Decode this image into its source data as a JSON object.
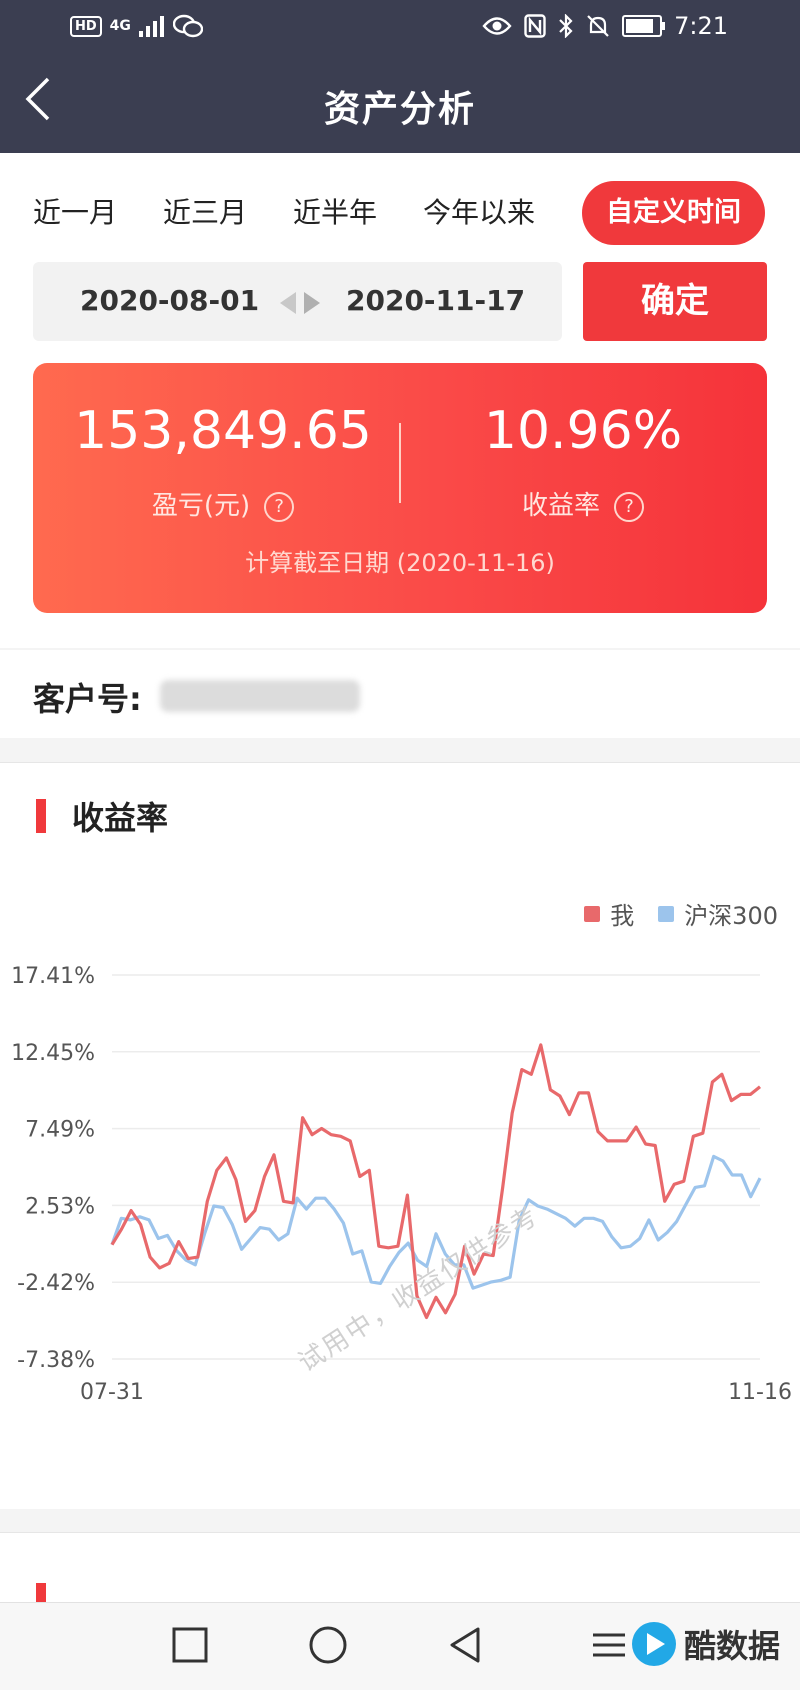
{
  "status": {
    "time": "7:21",
    "hd": "HD",
    "network": "4G",
    "battery_level": 0.85
  },
  "header": {
    "title": "资产分析",
    "back_glyph": "<"
  },
  "tabs": [
    {
      "label": "近一月",
      "active": false
    },
    {
      "label": "近三月",
      "active": false
    },
    {
      "label": "近半年",
      "active": false
    },
    {
      "label": "今年以来",
      "active": false
    },
    {
      "label": "自定义时间",
      "active": true
    }
  ],
  "date_range": {
    "start": "2020-08-01",
    "end": "2020-11-17",
    "confirm_label": "确定"
  },
  "summary": {
    "profit_value": "153,849.65",
    "profit_label": "盈亏(元)",
    "return_value": "10.96%",
    "return_label": "收益率",
    "help_glyph": "?",
    "calc_date": "计算截至日期 (2020-11-16)"
  },
  "client": {
    "label": "客户号:"
  },
  "section": {
    "title": "收益率"
  },
  "watermark": "试用中，收益仅供参考",
  "brand": {
    "name": "酷数据"
  },
  "colors": {
    "accent": "#f0393c",
    "mine": "#e8696b",
    "hs300": "#9cc4ec",
    "header_bg": "#3b3e51"
  },
  "chart_data": {
    "type": "line",
    "title": "",
    "xlabel": "",
    "ylabel": "",
    "x_ticks": [
      "07-31",
      "11-16"
    ],
    "y_ticks": [
      "17.41%",
      "12.45%",
      "7.49%",
      "2.53%",
      "-2.42%",
      "-7.38%"
    ],
    "ylim": [
      -7.38,
      17.41
    ],
    "grid": true,
    "legend_position": "top-right",
    "series": [
      {
        "name": "我",
        "color": "#e8696b",
        "values": [
          0.0,
          1.0,
          2.2,
          1.3,
          -0.8,
          -1.5,
          -1.2,
          0.2,
          -0.9,
          -0.8,
          2.8,
          4.8,
          5.6,
          4.2,
          1.5,
          2.2,
          4.4,
          5.8,
          2.8,
          2.7,
          8.2,
          7.1,
          7.5,
          7.1,
          7.0,
          6.7,
          4.4,
          4.8,
          -0.1,
          -0.2,
          -0.1,
          3.2,
          -3.3,
          -4.7,
          -3.4,
          -4.4,
          -3.2,
          -0.1,
          -1.9,
          -0.6,
          -0.7,
          3.7,
          8.5,
          11.3,
          11.0,
          12.9,
          10.0,
          9.6,
          8.4,
          9.8,
          9.8,
          7.3,
          6.7,
          6.7,
          6.7,
          7.6,
          6.5,
          6.4,
          2.8,
          3.9,
          4.1,
          7.0,
          7.2,
          10.5,
          11.0,
          9.3,
          9.7,
          9.7,
          10.2
        ]
      },
      {
        "name": "沪深300",
        "color": "#9cc4ec",
        "values": [
          0.0,
          1.7,
          1.6,
          1.8,
          1.6,
          0.4,
          0.6,
          -0.4,
          -1.0,
          -1.3,
          0.7,
          2.5,
          2.4,
          1.3,
          -0.3,
          0.4,
          1.1,
          1.0,
          0.3,
          0.7,
          3.0,
          2.3,
          3.0,
          3.0,
          2.3,
          1.4,
          -0.6,
          -0.4,
          -2.4,
          -2.5,
          -1.4,
          -0.5,
          0.1,
          -1.0,
          -1.4,
          0.7,
          -0.6,
          -1.3,
          -1.3,
          -2.8,
          -2.6,
          -2.4,
          -2.3,
          -2.1,
          1.6,
          2.9,
          2.5,
          2.3,
          2.0,
          1.7,
          1.2,
          1.7,
          1.7,
          1.5,
          0.5,
          -0.2,
          -0.1,
          0.4,
          1.6,
          0.3,
          0.8,
          1.5,
          2.6,
          3.7,
          3.8,
          5.7,
          5.4,
          4.5,
          4.5,
          3.1,
          4.3
        ]
      }
    ]
  }
}
